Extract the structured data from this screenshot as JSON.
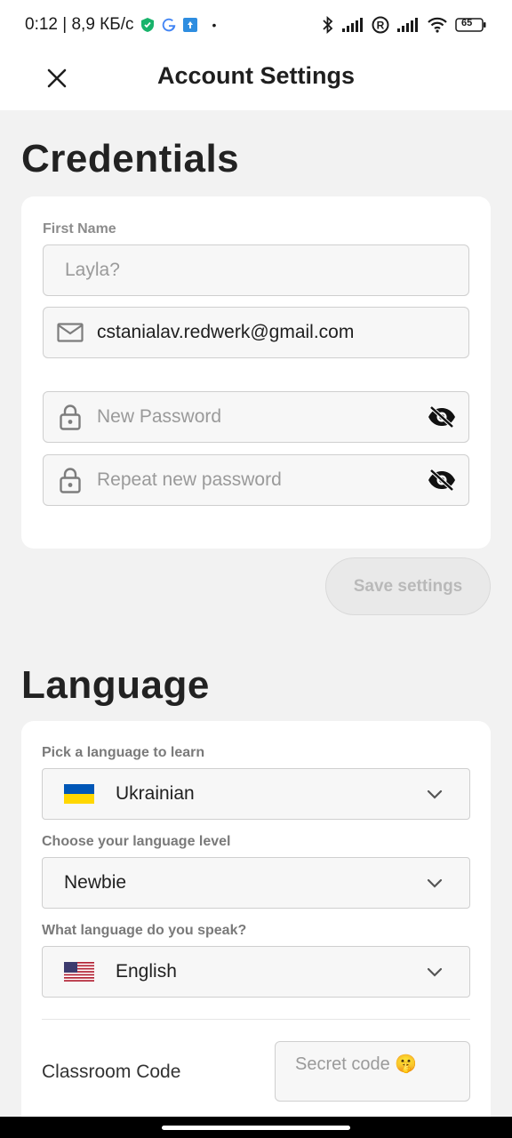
{
  "status_bar": {
    "left_text": "0:12 | 8,9 КБ/с",
    "dot": "•",
    "r_icon": "R",
    "battery": "65"
  },
  "header": {
    "title": "Account Settings"
  },
  "credentials": {
    "title": "Credentials",
    "first_name_label": "First Name",
    "first_name_placeholder": "Layla?",
    "email_value": "cstanialav.redwerk@gmail.com",
    "new_password_placeholder": "New Password",
    "repeat_password_placeholder": "Repeat new password",
    "save_label": "Save settings"
  },
  "language": {
    "title": "Language",
    "learn_label": "Pick a language to learn",
    "learn_value": "Ukrainian",
    "level_label": "Choose your language level",
    "level_value": "Newbie",
    "speak_label": "What language do you speak?",
    "speak_value": "English",
    "classroom_label": "Classroom Code",
    "classroom_placeholder": "Secret code 🤫"
  },
  "colors": {
    "background": "#f2f2f2",
    "card": "#ffffff",
    "disabled_button": "#e9e9e9",
    "flag_blue": "#0057b7",
    "flag_yellow": "#ffd700"
  }
}
